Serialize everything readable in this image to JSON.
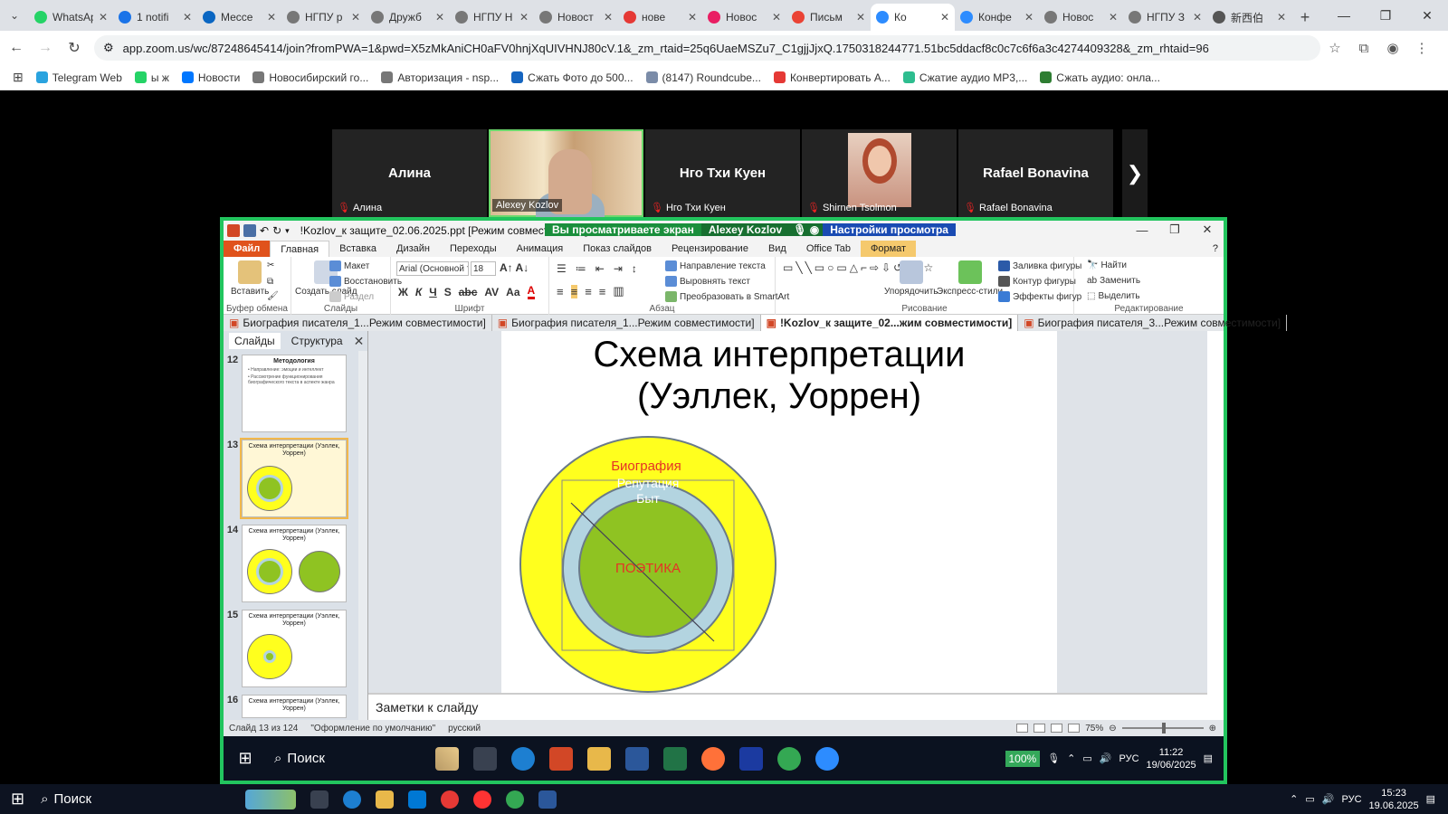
{
  "browser": {
    "tabs": [
      {
        "title": "WhatsApp",
        "color": "#25d366"
      },
      {
        "title": "1 notifi",
        "color": "#1a73e8"
      },
      {
        "title": "Мессе",
        "color": "#0a66c2"
      },
      {
        "title": "НГПУ р",
        "color": "#777777"
      },
      {
        "title": "Дружб",
        "color": "#777777"
      },
      {
        "title": "НГПУ Н",
        "color": "#777777"
      },
      {
        "title": "Новост",
        "color": "#777777"
      },
      {
        "title": "нове",
        "color": "#e53935"
      },
      {
        "title": "Новос",
        "color": "#e91e63"
      },
      {
        "title": "Письм",
        "color": "#ea4335"
      },
      {
        "title": "Ко",
        "color": "#2d8cff",
        "active": true
      },
      {
        "title": "Конфе",
        "color": "#2d8cff"
      },
      {
        "title": "Новос",
        "color": "#777777"
      },
      {
        "title": "НГПУ З",
        "color": "#777777"
      },
      {
        "title": "新西伯",
        "color": "#555555"
      }
    ],
    "url": "app.zoom.us/wc/87248645414/join?fromPWA=1&pwd=X5zMkAniCH0aFV0hnjXqUIVHNJ80cV.1&_zm_rtaid=25q6UaeMSZu7_C1gjjJjxQ.1750318244771.51bc5ddacf8c0c7c6f6a3c4274409328&_zm_rhtaid=96",
    "bookmarks": [
      {
        "label": "Telegram Web",
        "color": "#2aa3df"
      },
      {
        "label": "ы ж",
        "color": "#25d366"
      },
      {
        "label": "Новости",
        "color": "#0077ff"
      },
      {
        "label": "Новосибирский го...",
        "color": "#777777"
      },
      {
        "label": "Авторизация - nsp...",
        "color": "#777777"
      },
      {
        "label": "Сжать Фото до 500...",
        "color": "#1565c0"
      },
      {
        "label": "(8147) Roundcube...",
        "color": "#7b8ca8"
      },
      {
        "label": "Конвертировать А...",
        "color": "#e53935"
      },
      {
        "label": "Сжатие аудио MP3,...",
        "color": "#2ebd8f"
      },
      {
        "label": "Сжать аудио: онла...",
        "color": "#2e7d32"
      }
    ]
  },
  "zoom": {
    "participants": [
      {
        "name": "Алина",
        "display": "Алина"
      },
      {
        "name": "Alexey Kozlov",
        "display": ""
      },
      {
        "name": "Нго Тхи Куен",
        "display": "Нго Тхи Куен"
      },
      {
        "name": "Shirnen Tsolmon",
        "display": ""
      },
      {
        "name": "Rafael Bonavina",
        "display": "Rafael Bonavina"
      }
    ],
    "share_banner": "Вы просматриваете экран",
    "presenter": "Alexey Kozlov",
    "view_settings": "Настройки просмотра"
  },
  "ppt": {
    "file_title": "!Kozlov_к защите_02.06.2025.ppt [Режим совместимости]",
    "ribbon_tabs": [
      "Файл",
      "Главная",
      "Вставка",
      "Дизайн",
      "Переходы",
      "Анимация",
      "Показ слайдов",
      "Рецензирование",
      "Вид",
      "Office Tab",
      "Формат"
    ],
    "groups": {
      "clipboard": "Буфер обмена",
      "slides": "Слайды",
      "font": "Шрифт",
      "paragraph": "Абзац",
      "drawing": "Рисование",
      "editing": "Редактирование"
    },
    "buttons": {
      "paste": "Вставить",
      "create_slide": "Создать слайд",
      "layout": "Макет",
      "restore": "Восстановить",
      "section": "Раздел",
      "font_name": "Arial (Основной т",
      "font_size": "18",
      "text_dir": "Направление текста",
      "align_text": "Выровнять текст",
      "smartart": "Преобразовать в SmartArt",
      "arrange": "Упорядочить",
      "quick_styles": "Экспресс-стили",
      "fill": "Заливка фигуры",
      "outline": "Контур фигуры",
      "effects": "Эффекты фигур",
      "find": "Найти",
      "replace": "Заменить",
      "select": "Выделить"
    },
    "doc_tabs": [
      {
        "label": "Биография писателя_1...Режим совместимости]"
      },
      {
        "label": "Биография писателя_1...Режим совместимости]"
      },
      {
        "label": "!Kozlov_к защите_02...жим совместимости]",
        "active": true
      },
      {
        "label": "Биография писателя_3...Режим совместимости]"
      }
    ],
    "side_tabs": [
      "Слайды",
      "Структура"
    ],
    "thumbs": [
      {
        "num": "12",
        "title": "Методология",
        "lines": [
          "• Направление: эмоции и интеллект",
          "• Рассмотрение функционирования биографического текста в аспекте жанра"
        ]
      },
      {
        "num": "13",
        "title": "Схема интерпретации (Уэллек, Уоррен)"
      },
      {
        "num": "14",
        "title": "Схема интерпретации (Уэллек, Уоррен)"
      },
      {
        "num": "15",
        "title": "Схема интерпретации (Уэллек, Уоррен)"
      },
      {
        "num": "16",
        "title": "Схема интерпретации (Уэллек, Уоррен)"
      }
    ],
    "slide": {
      "title_line1": "Схема интерпретации",
      "title_line2": "(Уэллек, Уоррен)",
      "outer": "Биография",
      "middle1": "Репутация",
      "middle2": "Быт",
      "inner": "ПОЭТИКА",
      "colors": {
        "outer": "#ffff1e",
        "middle": "#b3d4e0",
        "inner": "#8fc322",
        "label": "#e53226"
      }
    },
    "notes": "Заметки к слайду",
    "status": {
      "slide": "Слайд 13 из 124",
      "theme": "\"Оформление по умолчанию\"",
      "lang": "русский",
      "zoom": "75%"
    }
  },
  "remote_taskbar": {
    "search": "Поиск",
    "zoom": "100%",
    "lang": "РУС",
    "time": "11:22",
    "date": "19/06/2025"
  },
  "local_taskbar": {
    "search": "Поиск",
    "lang": "РУС",
    "time": "15:23",
    "date": "19.06.2025"
  }
}
